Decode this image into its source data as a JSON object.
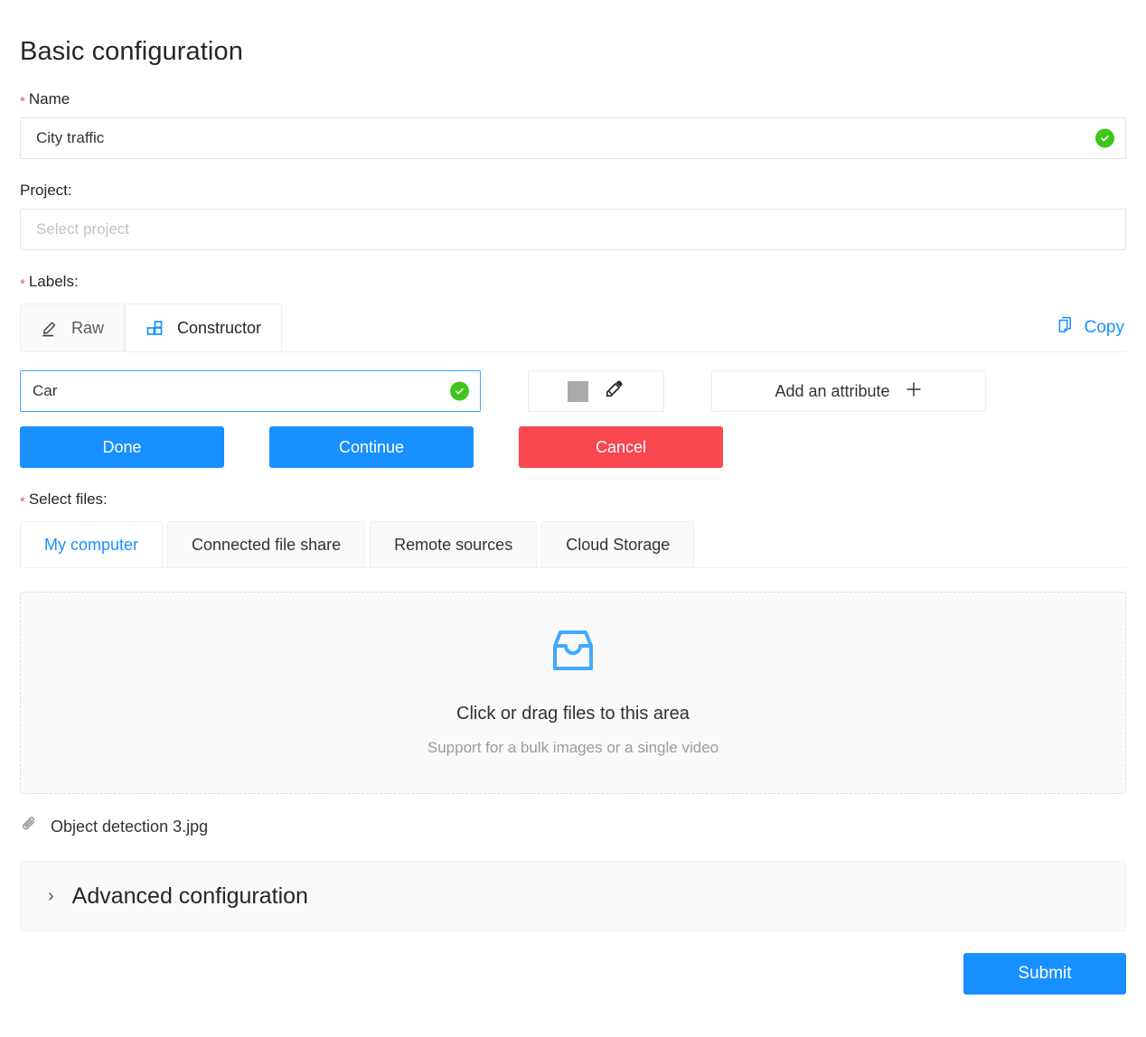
{
  "page": {
    "title": "Basic configuration"
  },
  "name_field": {
    "label": "Name",
    "required_marker": "*",
    "value": "City traffic",
    "placeholder": "",
    "valid_icon": "check-circle-icon"
  },
  "project_field": {
    "label": "Project:",
    "value": "",
    "placeholder": "Select project"
  },
  "labels_section": {
    "label": "Labels:",
    "required_marker": "*",
    "tabs": [
      {
        "label": "Raw",
        "icon": "pencil-icon",
        "active": false
      },
      {
        "label": "Constructor",
        "icon": "blocks-icon",
        "active": true
      }
    ],
    "copy": {
      "label": "Copy",
      "icon": "copy-icon"
    },
    "constructor": {
      "label_name_value": "Car",
      "label_name_placeholder": "",
      "valid_icon": "check-circle-icon",
      "color_swatch": "#aaaaaa",
      "color_picker_icon": "eyedropper-icon",
      "add_attribute_label": "Add an attribute",
      "add_attribute_icon": "plus-icon"
    },
    "actions": [
      {
        "label": "Done",
        "color": "#1890ff"
      },
      {
        "label": "Continue",
        "color": "#1890ff"
      },
      {
        "label": "Cancel",
        "color": "#f8474f"
      }
    ]
  },
  "select_files": {
    "label": "Select files:",
    "required_marker": "*",
    "tabs": [
      {
        "label": "My computer",
        "active": true
      },
      {
        "label": "Connected file share",
        "active": false
      },
      {
        "label": "Remote sources",
        "active": false
      },
      {
        "label": "Cloud Storage",
        "active": false
      }
    ],
    "dropzone": {
      "icon": "inbox-tray-icon",
      "title": "Click or drag files to this area",
      "hint": "Support for a bulk images or a single video"
    },
    "attached_files": [
      {
        "name": "Object detection 3.jpg",
        "icon": "paperclip-icon"
      }
    ]
  },
  "advanced": {
    "title": "Advanced configuration",
    "chevron": "›",
    "expanded": false
  },
  "submit": {
    "label": "Submit"
  },
  "colors": {
    "accent": "#1890ff",
    "danger": "#f8474f",
    "success": "#3fc61c",
    "required": "#f5545b"
  }
}
